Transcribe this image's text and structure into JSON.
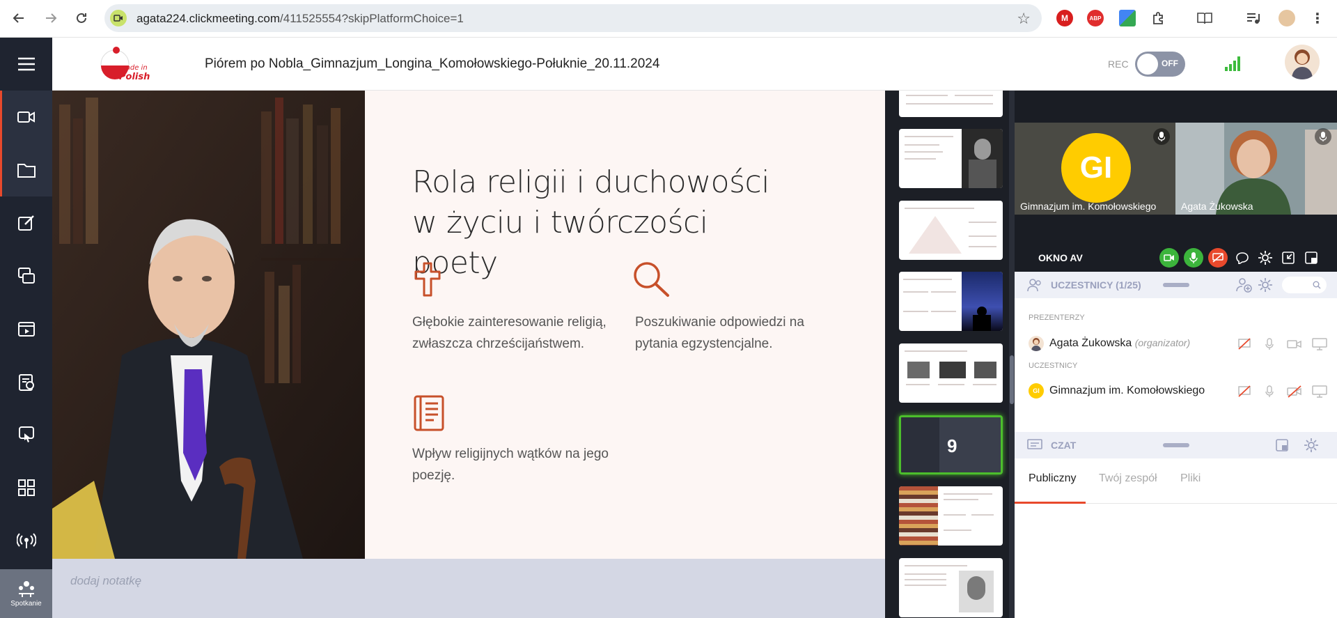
{
  "browser": {
    "url_host": "agata224.clickmeeting.com",
    "url_path": "/411525554?skipPlatformChoice=1",
    "extensions": [
      "M",
      "ABP"
    ]
  },
  "sidebar": {
    "items": [
      "menu-icon",
      "camera-icon",
      "folder-icon",
      "edit-icon",
      "screen-share-icon",
      "video-icon",
      "quiz-icon",
      "whiteboard-icon",
      "apps-icon",
      "broadcast-icon"
    ],
    "bottom_label": "Spotkanie"
  },
  "header": {
    "title": "Piórem po Nobla_Gimnazjum_Longina_Komołowskiego-Połuknie_20.11.2024",
    "rec_label": "REC",
    "rec_state": "OFF"
  },
  "slide": {
    "title": "Rola religii i duchowości w życiu i twórczości poety",
    "features": [
      {
        "icon": "cross-icon",
        "text": "Głębokie zainteresowanie religią, zwłaszcza chrześcijaństwem."
      },
      {
        "icon": "magnifier-icon",
        "text": "Poszukiwanie odpowiedzi na pytania egzystencjalne."
      },
      {
        "icon": "book-icon",
        "text": "Wpływ religijnych wątków na jego poezję."
      }
    ],
    "accent_color": "#c7502a"
  },
  "notes": {
    "placeholder": "dodaj notatkę"
  },
  "thumbnails": {
    "current_number": "9"
  },
  "av": {
    "tiles": [
      {
        "initials": "GI",
        "name": "Gimnazjum im. Komołowskiego"
      },
      {
        "name": "Agata Żukowska"
      }
    ],
    "toolbar_label": "OKNO AV"
  },
  "participants": {
    "title": "UCZESTNICY (1/25)",
    "presenters_label": "PREZENTERZY",
    "presenter_name": "Agata Żukowska",
    "presenter_role": "(organizator)",
    "attendees_label": "UCZESTNICY",
    "attendee_initials": "GI",
    "attendee_name": "Gimnazjum im. Komołowskiego"
  },
  "chat": {
    "title": "CZAT",
    "tabs": [
      "Publiczny",
      "Twój zespół",
      "Pliki"
    ]
  }
}
